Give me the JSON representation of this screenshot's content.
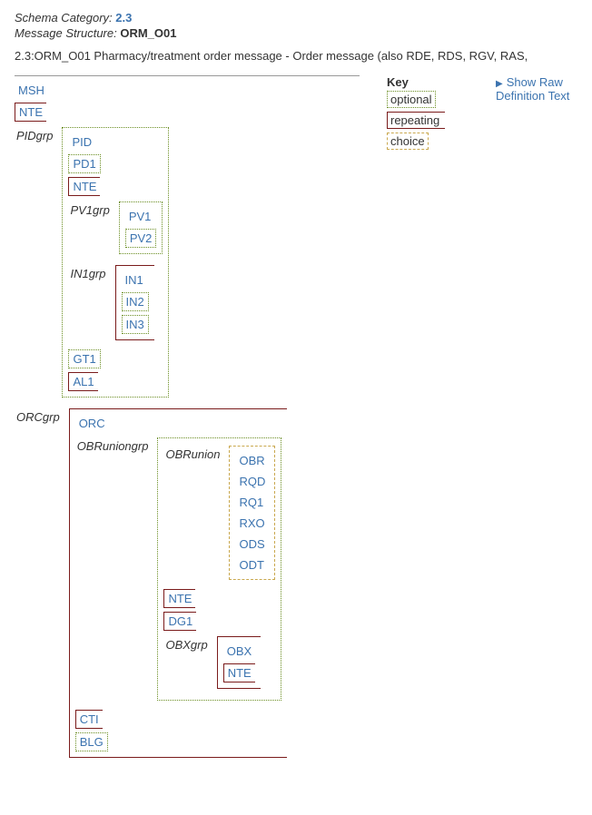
{
  "header": {
    "schema_cat_label": "Schema Category:",
    "schema_cat_value": "2.3",
    "msg_struct_label": "Message Structure:",
    "msg_struct_value": "ORM_O01"
  },
  "description": "2.3:ORM_O01 Pharmacy/treatment order message - Order message (also RDE, RDS, RGV, RAS,",
  "key": {
    "title": "Key",
    "optional": "optional",
    "repeating": "repeating",
    "choice": "choice"
  },
  "raw_link": "Show Raw Definition Text",
  "tree": {
    "MSH": "MSH",
    "NTE": "NTE",
    "PIDgrp": "PIDgrp",
    "PID": "PID",
    "PD1": "PD1",
    "PV1grp": "PV1grp",
    "PV1": "PV1",
    "PV2": "PV2",
    "IN1grp": "IN1grp",
    "IN1": "IN1",
    "IN2": "IN2",
    "IN3": "IN3",
    "GT1": "GT1",
    "AL1": "AL1",
    "ORCgrp": "ORCgrp",
    "ORC": "ORC",
    "OBRuniongrp": "OBRuniongrp",
    "OBRunion": "OBRunion",
    "OBR": "OBR",
    "RQD": "RQD",
    "RQ1": "RQ1",
    "RXO": "RXO",
    "ODS": "ODS",
    "ODT": "ODT",
    "DG1": "DG1",
    "OBXgrp": "OBXgrp",
    "OBX": "OBX",
    "CTI": "CTI",
    "BLG": "BLG"
  }
}
